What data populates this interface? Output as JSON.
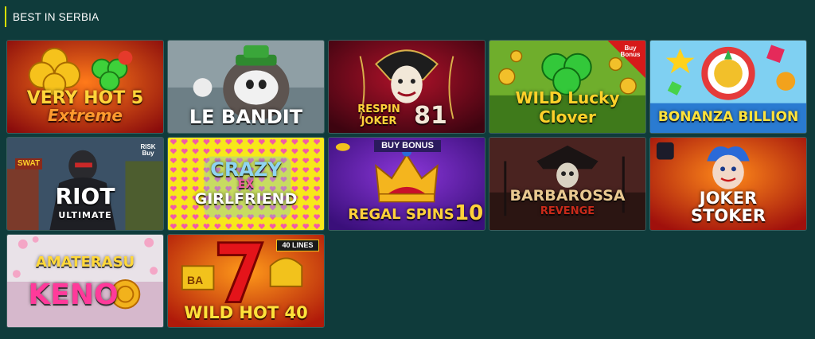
{
  "section": {
    "title": "BEST IN SERBIA"
  },
  "colors": {
    "background": "#0f3b3b",
    "accent": "#d8e000"
  },
  "games": [
    {
      "name": "Very Hot 5 Extreme",
      "title_line1": "VERY HOT 5",
      "title_line2": "Extreme"
    },
    {
      "name": "Le Bandit",
      "title_line1": "LE BANDIT"
    },
    {
      "name": "Respin Joker 81",
      "title_line1": "RESPIN",
      "title_line2": "JOKER",
      "number": "81"
    },
    {
      "name": "Wild Lucky Clover",
      "title_line1": "WILD Lucky",
      "title_line2": "Clover",
      "badge": "Buy Bonus"
    },
    {
      "name": "Bonanza Billion",
      "title_line1": "BONANZA BILLION"
    },
    {
      "name": "Riot Ultimate",
      "title_line1": "RIOT",
      "title_line2": "ULTIMATE",
      "badge": "RISK Buy",
      "sign": "SWAT"
    },
    {
      "name": "Crazy Ex Girlfriend",
      "title_line1": "CRAZY",
      "title_line2": "EX",
      "title_line3": "GIRLFRIEND"
    },
    {
      "name": "Regal Spins 10",
      "title_line1": "REGAL SPINS",
      "number": "10",
      "badge": "BUY BONUS"
    },
    {
      "name": "Barbarossa Revenge",
      "title_line1": "BARBAROSSA",
      "title_line2": "REVENGE"
    },
    {
      "name": "Joker Stoker",
      "title_line1": "JOKER",
      "title_line2": "STOKER"
    },
    {
      "name": "Amaterasu Keno",
      "title_line1": "AMATERASU",
      "title_line2": "KENO"
    },
    {
      "name": "Wild Hot 40",
      "title_line1": "WILD HOT 40",
      "badge": "40 LINES",
      "reel_text": "BA"
    }
  ]
}
